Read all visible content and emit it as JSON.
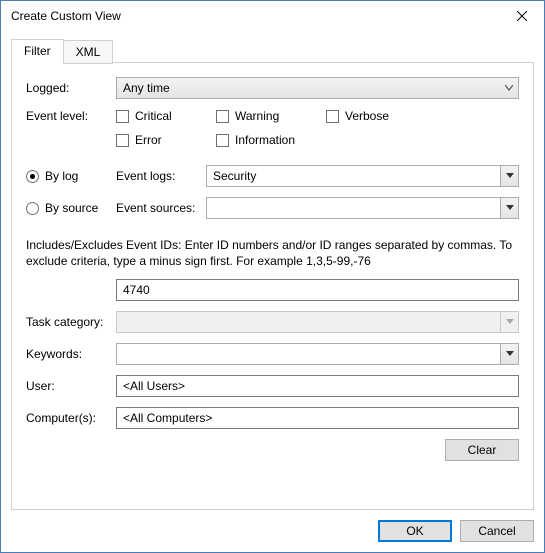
{
  "window": {
    "title": "Create Custom View"
  },
  "tabs": {
    "filter": "Filter",
    "xml": "XML"
  },
  "labels": {
    "logged": "Logged:",
    "eventLevel": "Event level:",
    "byLog": "By log",
    "bySource": "By source",
    "eventLogs": "Event logs:",
    "eventSources": "Event sources:",
    "taskCategory": "Task category:",
    "keywords": "Keywords:",
    "user": "User:",
    "computers": "Computer(s):"
  },
  "logged": {
    "value": "Any time"
  },
  "levels": {
    "critical": "Critical",
    "warning": "Warning",
    "verbose": "Verbose",
    "error": "Error",
    "information": "Information"
  },
  "eventLogs": {
    "value": "Security"
  },
  "eventSources": {
    "value": ""
  },
  "idDesc": "Includes/Excludes Event IDs: Enter ID numbers and/or ID ranges separated by commas. To exclude criteria, type a minus sign first. For example 1,3,5-99,-76",
  "eventId": {
    "value": "4740"
  },
  "taskCategory": {
    "value": ""
  },
  "keywords": {
    "value": ""
  },
  "user": {
    "value": "<All Users>"
  },
  "computers": {
    "value": "<All Computers>"
  },
  "buttons": {
    "clear": "Clear",
    "ok": "OK",
    "cancel": "Cancel"
  }
}
